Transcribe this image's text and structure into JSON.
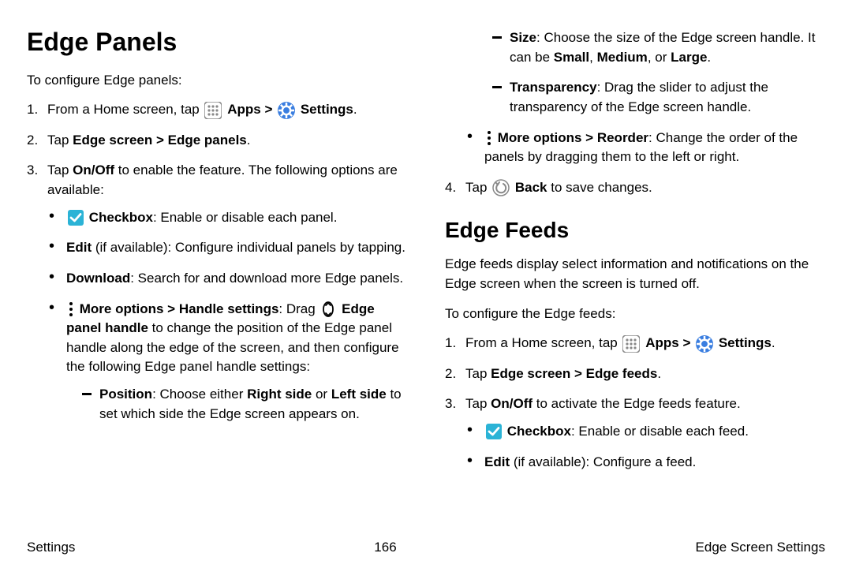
{
  "left": {
    "heading": "Edge Panels",
    "intro": "To configure Edge panels:",
    "step1_a": "From a Home screen, tap ",
    "step1_apps": "Apps",
    "step1_gt": " > ",
    "step1_settings": "Settings",
    "step1_dot": ".",
    "step2_a": "Tap ",
    "step2_b": "Edge screen > Edge panels",
    "step2_c": ".",
    "step3_a": "Tap ",
    "step3_b": "On/Off",
    "step3_c": " to enable the feature. The following options are available:",
    "b_check_b": "Checkbox",
    "b_check_c": ": Enable or disable each panel.",
    "b_edit_b": "Edit",
    "b_edit_c": " (if available): Configure individual panels by tapping.",
    "b_dl_b": "Download",
    "b_dl_c": ": Search for and download more Edge panels.",
    "b_more_b": "More options > Handle settings",
    "b_more_c": ": Drag ",
    "b_more_handle": "Edge panel handle",
    "b_more_rest": " to change the position of the Edge panel handle along the edge of the screen, and then configure the following Edge panel handle settings:",
    "d_pos_b": "Position",
    "d_pos_c1": ": Choose either ",
    "d_pos_right": "Right side",
    "d_pos_or": " or ",
    "d_pos_left": "Left side",
    "d_pos_c2": " to set which side the Edge screen appears on."
  },
  "right": {
    "d_size_b": "Size",
    "d_size_c1": ": Choose the size of the Edge screen handle. It can be ",
    "d_size_small": "Small",
    "d_size_comma": ", ",
    "d_size_med": "Medium",
    "d_size_or": ", or ",
    "d_size_large": "Large",
    "d_size_dot": ".",
    "d_trans_b": "Transparency",
    "d_trans_c": ": Drag the slider to adjust the transparency of the Edge screen handle.",
    "b_reorder_b": "More options > Reorder",
    "b_reorder_c": ": Change the order of the panels by dragging them to the left or right.",
    "step4_a": "Tap ",
    "step4_back": "Back",
    "step4_c": " to save changes.",
    "h2": "Edge Feeds",
    "feeds_intro": "Edge feeds display select information and notifications on the Edge screen when the screen is turned off.",
    "feeds_config": "To configure the Edge feeds:",
    "f1_a": "From a Home screen, tap ",
    "f1_apps": "Apps",
    "f1_gt": " > ",
    "f1_settings": "Settings",
    "f1_dot": ".",
    "f2_a": "Tap ",
    "f2_b": "Edge screen > Edge feeds",
    "f2_c": ".",
    "f3_a": "Tap ",
    "f3_b": "On/Off",
    "f3_c": " to activate the Edge feeds feature.",
    "fb_check_b": "Checkbox",
    "fb_check_c": ": Enable or disable each feed.",
    "fb_edit_b": "Edit",
    "fb_edit_c": " (if available): Configure a feed."
  },
  "footer": {
    "left": "Settings",
    "center": "166",
    "right": "Edge Screen Settings"
  }
}
